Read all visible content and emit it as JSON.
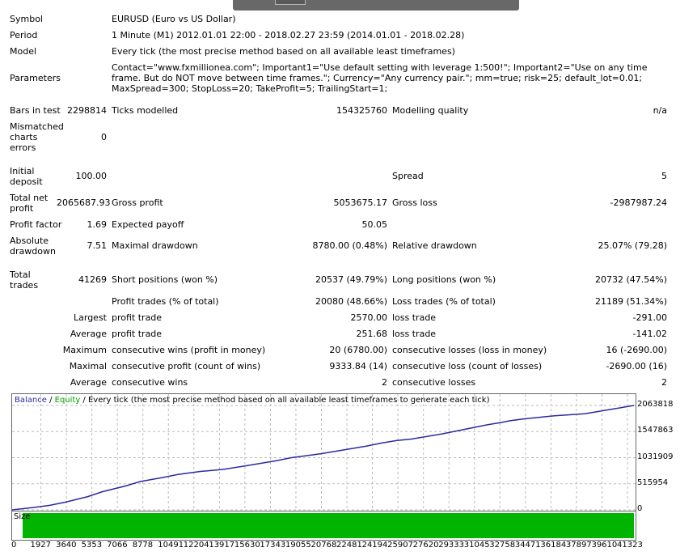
{
  "header": {
    "symbol_label": "Symbol",
    "symbol": "EURUSD (Euro vs US Dollar)",
    "period_label": "Period",
    "period": "1 Minute (M1) 2012.01.01 22:00 - 2018.02.27 23:59 (2014.01.01 - 2018.02.28)",
    "model_label": "Model",
    "model": "Every tick (the most precise method based on all available least timeframes)",
    "params_label": "Parameters",
    "params": "Contact=\"www.fxmillionea.com\"; Important1=\"Use default setting with leverage 1:500!\"; Important2=\"Use on any time frame. But do NOT move between time frames.\"; Currency=\"Any currency pair.\"; mm=true; risk=25; default_lot=0.01; MaxSpread=300; StopLoss=20; TakeProfit=5; TrailingStart=1;"
  },
  "stats": {
    "bars_label": "Bars in test",
    "bars": "2298814",
    "ticks_label": "Ticks modelled",
    "ticks": "154325760",
    "mq_label": "Modelling quality",
    "mq": "n/a",
    "mismatch_label": "Mismatched charts errors",
    "mismatch": "0",
    "deposit_label": "Initial deposit",
    "deposit": "100.00",
    "spread_label": "Spread",
    "spread": "5",
    "net_label": "Total net profit",
    "net": "2065687.93",
    "gp_label": "Gross profit",
    "gp": "5053675.17",
    "gl_label": "Gross loss",
    "gl": "-2987987.24",
    "pf_label": "Profit factor",
    "pf": "1.69",
    "ep_label": "Expected payoff",
    "ep": "50.05",
    "ad_label": "Absolute drawdown",
    "ad": "7.51",
    "md_label": "Maximal drawdown",
    "md": "8780.00 (0.48%)",
    "rd_label": "Relative drawdown",
    "rd": "25.07% (79.28)",
    "tt_label": "Total trades",
    "tt": "41269",
    "sp_label": "Short positions (won %)",
    "sp": "20537 (49.79%)",
    "lp_label": "Long positions (won %)",
    "lp": "20732 (47.54%)",
    "pt_label": "Profit trades (% of total)",
    "pt": "20080 (48.66%)",
    "lt_label": "Loss trades (% of total)",
    "lt": "21189 (51.34%)",
    "largest": "Largest",
    "average": "Average",
    "maximum": "Maximum",
    "maximal": "Maximal",
    "profit_trade": "profit trade",
    "loss_trade": "loss trade",
    "lpt": "2570.00",
    "llt": "-291.00",
    "apt": "251.68",
    "alt": "-141.02",
    "cw_label": "consecutive wins (profit in money)",
    "cw": "20 (6780.00)",
    "cl_label": "consecutive losses (loss in money)",
    "cl": "16 (-2690.00)",
    "cp_label": "consecutive profit (count of wins)",
    "cp": "9333.84 (14)",
    "closs_label": "consecutive loss (count of losses)",
    "closs": "-2690.00 (16)",
    "acw_label": "consecutive wins",
    "acw": "2",
    "acl_label": "consecutive losses",
    "acl": "2"
  },
  "chart": {
    "legend_balance": "Balance",
    "legend_sep": " / ",
    "legend_equity": "Equity",
    "legend_rest": " / Every tick (the most precise method based on all available least timeframes to generate each tick)",
    "size_label": "Size",
    "colors": {
      "balance": "#2b2b9e",
      "equity": "#00a000",
      "size": "#00b400"
    }
  },
  "chart_data": {
    "type": "line",
    "title": "",
    "yticks": [
      "2063818",
      "1547863",
      "1031909",
      "515954",
      "0"
    ],
    "ylim": [
      0,
      2063818
    ],
    "xticks": [
      "0",
      "1927",
      "3640",
      "5353",
      "7066",
      "8778",
      "10491",
      "12204",
      "13917",
      "15630",
      "17343",
      "19055",
      "20768",
      "22481",
      "24194",
      "25907",
      "27620",
      "29333",
      "31045",
      "32758",
      "34471",
      "36184",
      "37897",
      "39610",
      "41323"
    ],
    "xlim": [
      0,
      41269
    ],
    "series": [
      {
        "name": "Balance",
        "x": [
          0,
          1500,
          2500,
          3500,
          5000,
          6000,
          7500,
          8500,
          10000,
          11000,
          12500,
          14000,
          15500,
          16500,
          17500,
          18500,
          19500,
          20500,
          21500,
          22500,
          23500,
          24500,
          25500,
          26500,
          27500,
          28500,
          29500,
          30500,
          31500,
          32500,
          33000,
          34000,
          35000,
          36000,
          37000,
          38000,
          39000,
          40000,
          41269
        ],
        "y": [
          0,
          50000,
          90000,
          150000,
          260000,
          360000,
          470000,
          560000,
          640000,
          700000,
          760000,
          800000,
          870000,
          920000,
          970000,
          1030000,
          1070000,
          1110000,
          1160000,
          1210000,
          1260000,
          1320000,
          1370000,
          1400000,
          1450000,
          1500000,
          1560000,
          1620000,
          1680000,
          1730000,
          1760000,
          1800000,
          1830000,
          1860000,
          1880000,
          1900000,
          1950000,
          2000000,
          2063818
        ]
      }
    ]
  }
}
